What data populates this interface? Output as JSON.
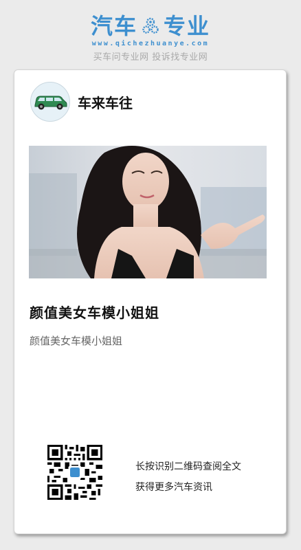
{
  "brand": {
    "logo_left": "汽车",
    "logo_right": "专业",
    "url": "www.qichezhuanye.com",
    "tagline": "买车问专业网 投诉找专业网",
    "accent_color": "#3d8fcf"
  },
  "author": {
    "avatar_icon": "green-suv-icon",
    "name": "车来车往"
  },
  "article": {
    "cover_image": "car-model-photo",
    "title": "颜值美女车模小姐姐",
    "summary": "颜值美女车模小姐姐"
  },
  "share": {
    "qr_icon": "qr-code",
    "line1": "长按识别二维码查阅全文",
    "line2": "获得更多汽车资讯"
  }
}
